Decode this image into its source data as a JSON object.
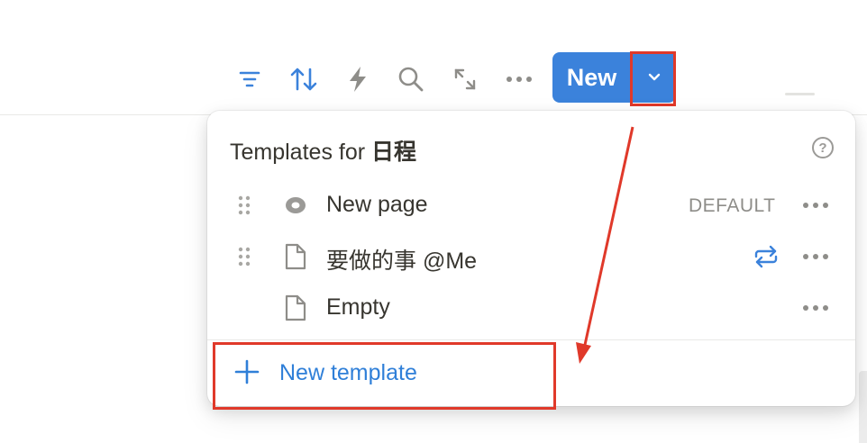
{
  "toolbar": {
    "icons": [
      "filter-icon",
      "sort-icon",
      "automation-icon",
      "search-icon",
      "expand-icon",
      "more-icon"
    ],
    "new_label": "New",
    "accent": "#3b82db"
  },
  "templates_popup": {
    "title_prefix": "Templates for ",
    "database_name": "日程",
    "items": [
      {
        "label": "New page",
        "badge": "DEFAULT",
        "icon": "page-circle-icon",
        "draggable": true
      },
      {
        "label": "要做的事 @Me",
        "icon": "page-icon",
        "repeat": true,
        "draggable": true
      },
      {
        "label": "Empty",
        "icon": "page-icon",
        "draggable": false
      }
    ],
    "new_template_label": "New template",
    "link_color": "#2f7fd8"
  },
  "annotations": {
    "highlight_color": "#e0392a"
  }
}
